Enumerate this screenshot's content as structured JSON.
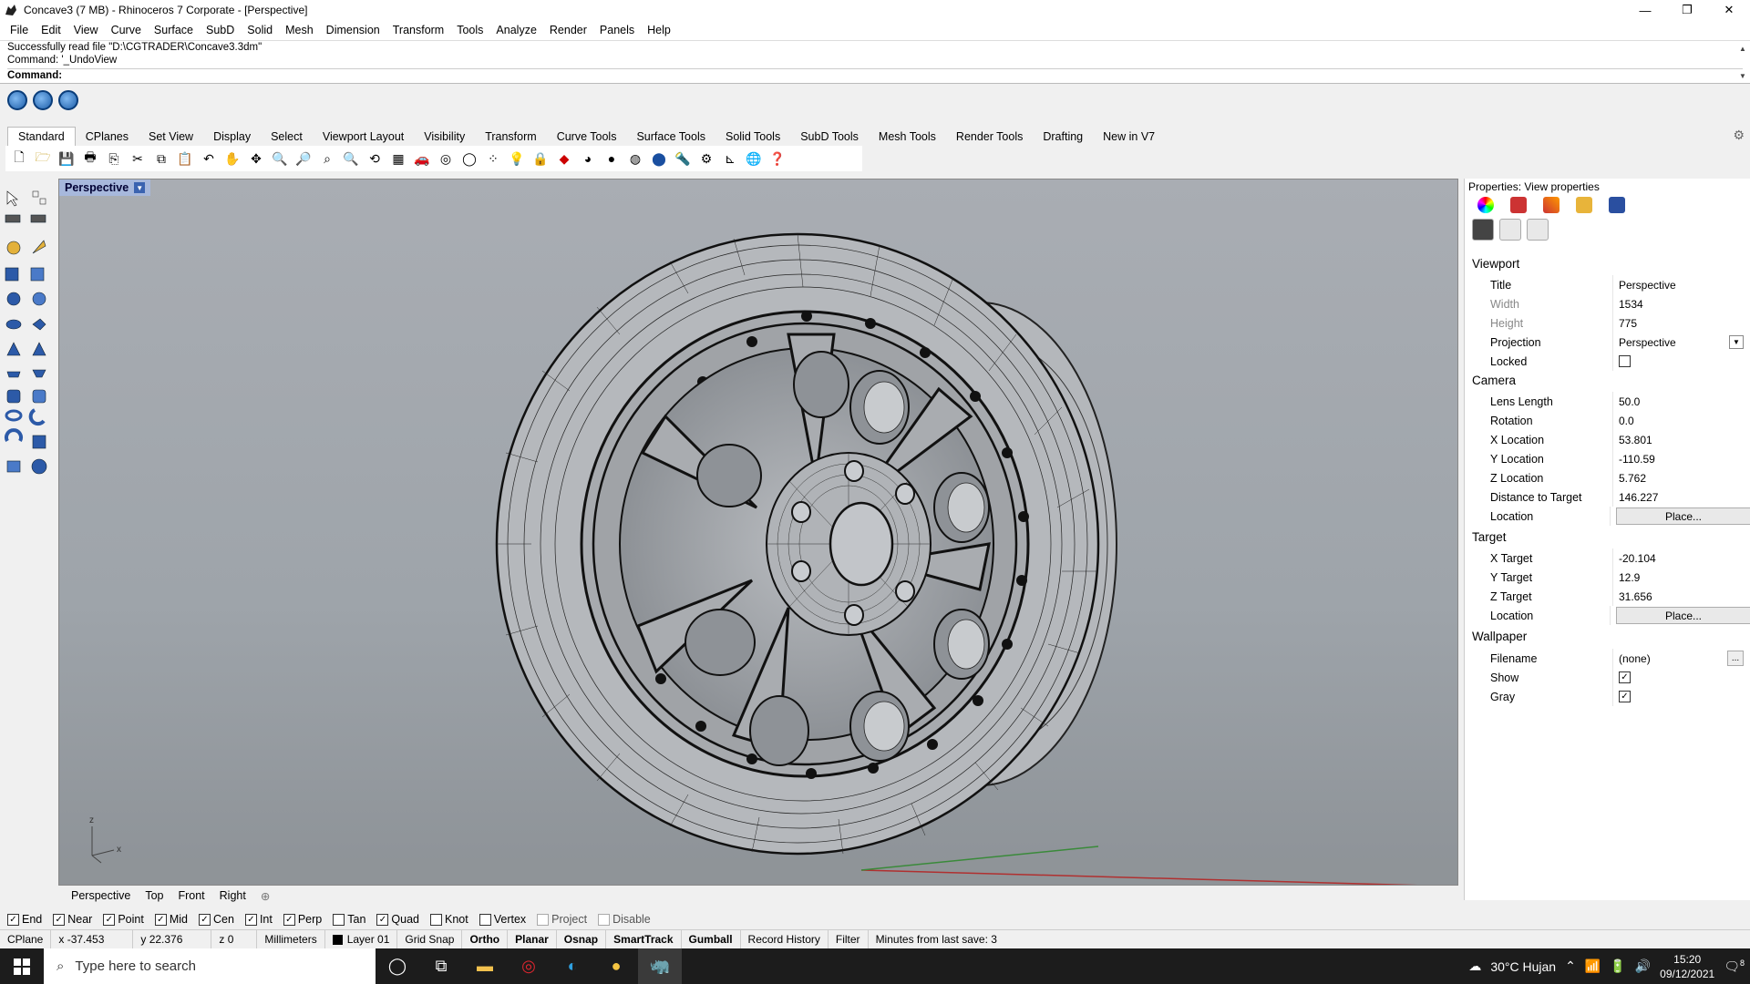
{
  "window": {
    "title": "Concave3 (7 MB) - Rhinoceros 7 Corporate - [Perspective]",
    "minimize": "—",
    "restore": "❐",
    "close": "✕"
  },
  "menu": [
    "File",
    "Edit",
    "View",
    "Curve",
    "Surface",
    "SubD",
    "Solid",
    "Mesh",
    "Dimension",
    "Transform",
    "Tools",
    "Analyze",
    "Render",
    "Panels",
    "Help"
  ],
  "command": {
    "line1": "Successfully read file \"D:\\CGTRADER\\Concave3.3dm\"",
    "line2": "Command: '_UndoView",
    "prompt": "Command:"
  },
  "tabs": [
    "Standard",
    "CPlanes",
    "Set View",
    "Display",
    "Select",
    "Viewport Layout",
    "Visibility",
    "Transform",
    "Curve Tools",
    "Surface Tools",
    "Solid Tools",
    "SubD Tools",
    "Mesh Tools",
    "Render Tools",
    "Drafting",
    "New in V7"
  ],
  "viewport": {
    "label": "Perspective",
    "tabs": [
      "Perspective",
      "Top",
      "Front",
      "Right"
    ],
    "axis_z": "z",
    "axis_x": "x"
  },
  "properties": {
    "header": "Properties: View properties",
    "viewport_section": "Viewport",
    "title_label": "Title",
    "title_value": "Perspective",
    "width_label": "Width",
    "width_value": "1534",
    "height_label": "Height",
    "height_value": "775",
    "projection_label": "Projection",
    "projection_value": "Perspective",
    "locked_label": "Locked",
    "camera_section": "Camera",
    "lens_label": "Lens Length",
    "lens_value": "50.0",
    "rotation_label": "Rotation",
    "rotation_value": "0.0",
    "xloc_label": "X Location",
    "xloc_value": "53.801",
    "yloc_label": "Y Location",
    "yloc_value": "-110.59",
    "zloc_label": "Z Location",
    "zloc_value": "5.762",
    "dist_label": "Distance to Target",
    "dist_value": "146.227",
    "location_label": "Location",
    "place_label": "Place...",
    "target_section": "Target",
    "xt_label": "X Target",
    "xt_value": "-20.104",
    "yt_label": "Y Target",
    "yt_value": "12.9",
    "zt_label": "Z Target",
    "zt_value": "31.656",
    "wallpaper_section": "Wallpaper",
    "filename_label": "Filename",
    "filename_value": "(none)",
    "browse_label": "...",
    "show_label": "Show",
    "gray_label": "Gray"
  },
  "osnap": [
    {
      "label": "End",
      "checked": true
    },
    {
      "label": "Near",
      "checked": true
    },
    {
      "label": "Point",
      "checked": true
    },
    {
      "label": "Mid",
      "checked": true
    },
    {
      "label": "Cen",
      "checked": true
    },
    {
      "label": "Int",
      "checked": true
    },
    {
      "label": "Perp",
      "checked": true
    },
    {
      "label": "Tan",
      "checked": false
    },
    {
      "label": "Quad",
      "checked": true
    },
    {
      "label": "Knot",
      "checked": false
    },
    {
      "label": "Vertex",
      "checked": false
    },
    {
      "label": "Project",
      "checked": false
    },
    {
      "label": "Disable",
      "checked": false
    }
  ],
  "status": {
    "cplane": "CPlane",
    "x": "x -37.453",
    "y": "y 22.376",
    "z": "z 0",
    "units": "Millimeters",
    "layer": "Layer 01",
    "grid": "Grid Snap",
    "ortho": "Ortho",
    "planar": "Planar",
    "osnap": "Osnap",
    "smarttrack": "SmartTrack",
    "gumball": "Gumball",
    "history": "Record History",
    "filter": "Filter",
    "save": "Minutes from last save: 3"
  },
  "taskbar": {
    "search_placeholder": "Type here to search",
    "weather": "30°C  Hujan",
    "time": "15:20",
    "date": "09/12/2021",
    "notif": "8"
  }
}
